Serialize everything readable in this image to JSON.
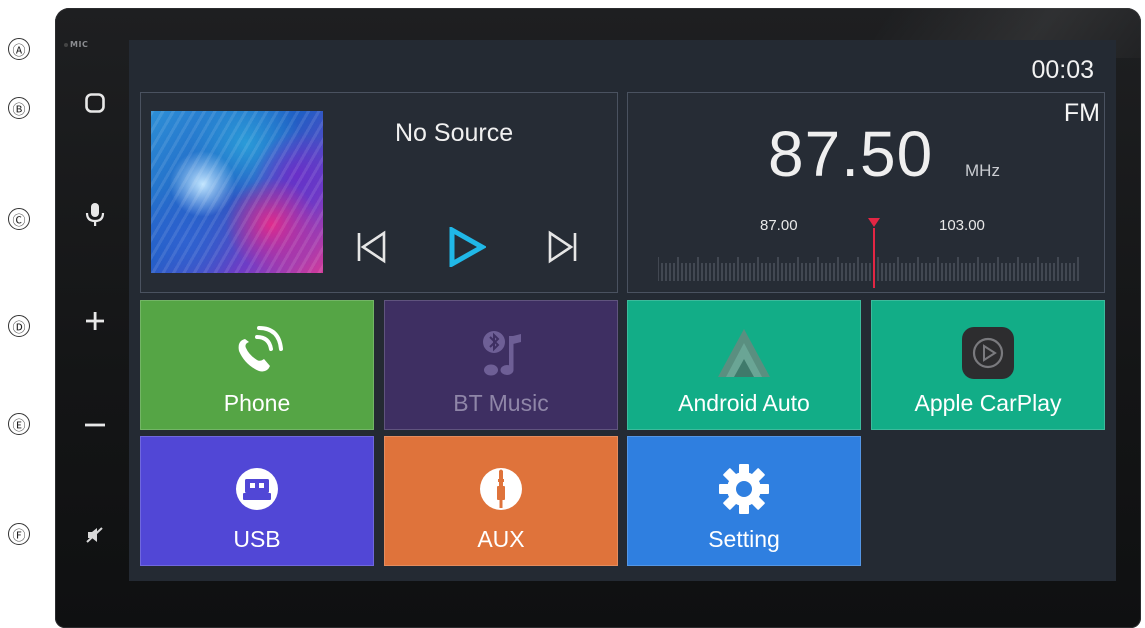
{
  "callouts": [
    "Ⓐ",
    "Ⓑ",
    "Ⓒ",
    "Ⓓ",
    "Ⓔ",
    "Ⓕ"
  ],
  "device": {
    "mic_label": "MIC",
    "side_buttons": [
      "home-icon",
      "voice-mic-icon",
      "volume-up-icon",
      "volume-down-icon",
      "mute-icon"
    ]
  },
  "status": {
    "clock": "00:03"
  },
  "media": {
    "source": "No Source",
    "controls": {
      "prev": "previous-track-icon",
      "play": "play-icon",
      "next": "next-track-icon"
    },
    "accent": "#20b8e8"
  },
  "radio": {
    "band": "FM",
    "frequency": "87.50",
    "unit": "MHz",
    "scale_low": "87.00",
    "scale_high": "103.00",
    "needle_color": "#e32644"
  },
  "apps": [
    {
      "label": "Phone",
      "icon": "phone-icon",
      "color": "#55a545"
    },
    {
      "label": "BT Music",
      "icon": "bluetooth-music-icon",
      "color": "#3e2f62"
    },
    {
      "label": "Android Auto",
      "icon": "android-auto-icon",
      "color": "#12ad87"
    },
    {
      "label": "Apple CarPlay",
      "icon": "carplay-icon",
      "color": "#12ad87"
    },
    {
      "label": "USB",
      "icon": "usb-icon",
      "color": "#5147d6"
    },
    {
      "label": "AUX",
      "icon": "aux-jack-icon",
      "color": "#df733b"
    },
    {
      "label": "Setting",
      "icon": "gear-icon",
      "color": "#2f7fe0"
    }
  ]
}
